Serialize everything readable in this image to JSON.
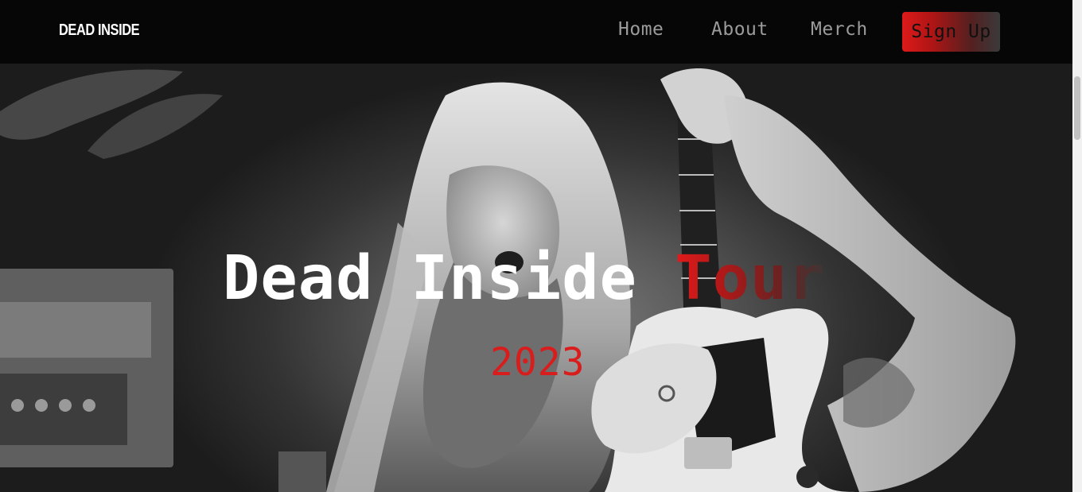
{
  "navbar": {
    "brand": "DEAD INSIDE",
    "links": [
      {
        "label": "Home"
      },
      {
        "label": "About"
      },
      {
        "label": "Merch"
      }
    ],
    "signup_label": "Sign Up"
  },
  "hero": {
    "title_main": "Dead Inside ",
    "title_accent": "Tour",
    "year": "2023",
    "background_image": "black-and-white photo of long-haired bearded guitarist playing a white electric guitar"
  },
  "colors": {
    "navbar_bg": "#060606",
    "accent_red": "#dd1a1a",
    "nav_link_gray": "#9b9b9b",
    "title_white": "#ffffff"
  }
}
